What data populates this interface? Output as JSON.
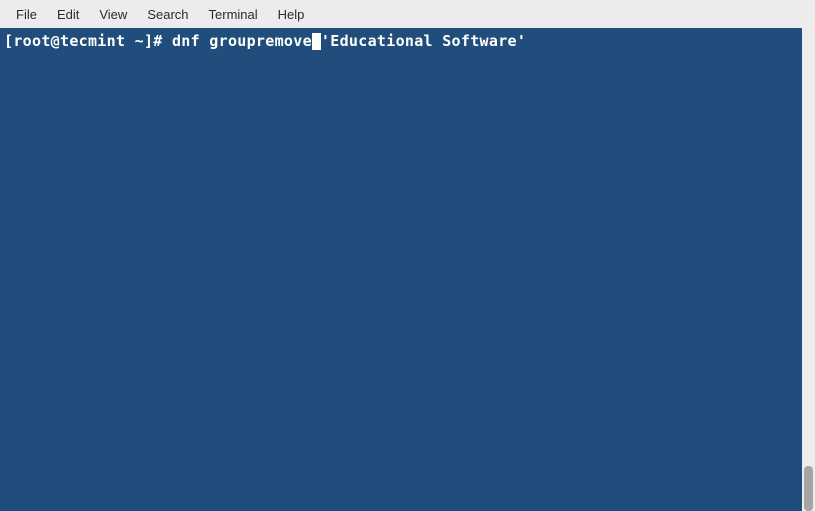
{
  "menubar": {
    "items": [
      "File",
      "Edit",
      "View",
      "Search",
      "Terminal",
      "Help"
    ]
  },
  "terminal": {
    "prompt_part1": "[root@tecmint ~]# dnf groupremove",
    "prompt_part2": "'Educational Software'"
  }
}
